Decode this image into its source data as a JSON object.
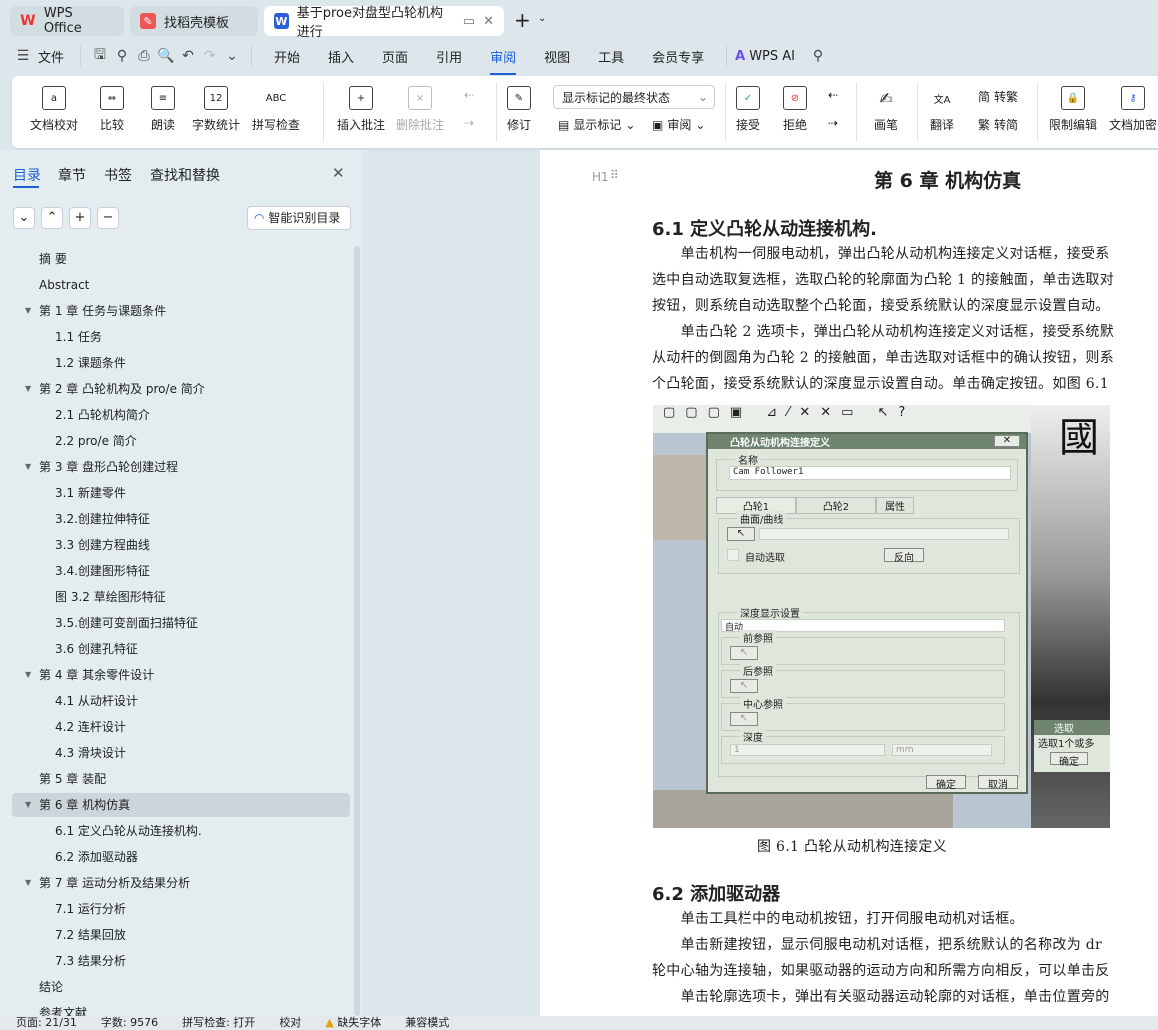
{
  "tabs": [
    {
      "label": "WPS Office",
      "color": "#e33"
    },
    {
      "label": "找稻壳模板",
      "color": "#e55"
    },
    {
      "label": "基于proe对盘型凸轮机构进行",
      "color": "#2b5fd9"
    }
  ],
  "menu": {
    "file": "文件",
    "items": [
      "开始",
      "插入",
      "页面",
      "引用",
      "审阅",
      "视图",
      "工具",
      "会员专享"
    ],
    "active": "审阅",
    "ai": "WPS AI"
  },
  "ribbon": {
    "proof": "文档校对",
    "compare": "比较",
    "read": "朗读",
    "wordcount": "字数统计",
    "spell": "拼写检查",
    "insert_comment": "插入批注",
    "delete_comment": "删除批注",
    "track": "修订",
    "display_select": "显示标记的最终状态",
    "show_markup": "显示标记",
    "review": "审阅",
    "accept": "接受",
    "reject": "拒绝",
    "pen": "画笔",
    "translate": "翻译",
    "to_trad": "转繁",
    "to_simp": "转简",
    "restrict": "限制编辑",
    "encrypt": "文档加密"
  },
  "sidebar": {
    "tabs": [
      "目录",
      "章节",
      "书签",
      "查找和替换"
    ],
    "smart_toc": "智能识别目录",
    "toc": [
      {
        "label": "摘 要",
        "level": 1
      },
      {
        "label": "Abstract",
        "level": 1
      },
      {
        "label": "第 1 章   任务与课题条件",
        "level": 1,
        "expand": true
      },
      {
        "label": "1.1  任务",
        "level": 2
      },
      {
        "label": "1.2  课题条件",
        "level": 2
      },
      {
        "label": "第 2 章  凸轮机构及 pro/e 简介",
        "level": 1,
        "expand": true
      },
      {
        "label": "2.1  凸轮机构简介",
        "level": 2
      },
      {
        "label": "2.2 pro/e 简介",
        "level": 2
      },
      {
        "label": "第 3 章  盘形凸轮创建过程",
        "level": 1,
        "expand": true
      },
      {
        "label": "3.1  新建零件",
        "level": 2
      },
      {
        "label": "3.2.创建拉伸特征",
        "level": 2
      },
      {
        "label": "3.3  创建方程曲线",
        "level": 2
      },
      {
        "label": "3.4.创建图形特征",
        "level": 2
      },
      {
        "label": "图 3.2  草绘图形特征",
        "level": 2
      },
      {
        "label": "3.5.创建可变剖面扫描特征",
        "level": 2
      },
      {
        "label": "3.6 创建孔特征",
        "level": 2
      },
      {
        "label": "第 4 章    其余零件设计",
        "level": 1,
        "expand": true
      },
      {
        "label": "4.1 从动杆设计",
        "level": 2
      },
      {
        "label": "4.2 连杆设计",
        "level": 2
      },
      {
        "label": "4.3 滑块设计",
        "level": 2
      },
      {
        "label": "第 5 章  装配",
        "level": 1
      },
      {
        "label": "第 6 章  机构仿真",
        "level": 1,
        "expand": true,
        "selected": true
      },
      {
        "label": "6.1  定义凸轮从动连接机构.",
        "level": 2
      },
      {
        "label": "6.2  添加驱动器",
        "level": 2
      },
      {
        "label": "第 7 章    运动分析及结果分析",
        "level": 1,
        "expand": true
      },
      {
        "label": "7.1  运行分析",
        "level": 2
      },
      {
        "label": "7.2     结果回放",
        "level": 2
      },
      {
        "label": "7.3     结果分析",
        "level": 2
      },
      {
        "label": "结论",
        "level": 1
      },
      {
        "label": "参考文献",
        "level": 1
      }
    ]
  },
  "doc": {
    "heading_marker": "H1",
    "chapter": "第 6 章  机构仿真",
    "s1": "6.1  定义凸轮从动连接机构.",
    "p1": [
      "　　单击机构一伺服电动机，弹出凸轮从动机构连接定义对话框，接受系",
      "选中自动选取复选框，选取凸轮的轮廓面为凸轮 1 的接触面，单击选取对",
      "按钮，则系统自动选取整个凸轮面，接受系统默认的深度显示设置自动。",
      "　　单击凸轮 2 选项卡，弹出凸轮从动机构连接定义对话框，接受系统默",
      "从动杆的倒圆角为凸轮 2 的接触面，单击选取对话框中的确认按钮，则系",
      "个凸轮面，接受系统默认的深度显示设置自动。单击确定按钮。如图 6.1"
    ],
    "caption": "图 6.1 凸轮从动机构连接定义",
    "s2": "6.2  添加驱动器",
    "p2": [
      "　　单击工具栏中的电动机按钮，打开伺服电动机对话框。",
      "　　单击新建按钮，显示伺服电动机对话框，把系统默认的名称改为 dr",
      "轮中心轴为连接轴，如果驱动器的运动方向和所需方向相反，可以单击反",
      "　　单击轮廓选项卡，弹出有关驱动器运动轮廓的对话框，单击位置旁的"
    ]
  },
  "figure": {
    "title": "凸轮从动机构连接定义",
    "name_label": "名称",
    "name_value": "Cam Follower1",
    "tabs": [
      "凸轮1",
      "凸轮2",
      "属性"
    ],
    "surface": "曲面/曲线",
    "auto": "自动选取",
    "reverse": "反向",
    "depth_settings": "深度显示设置",
    "depth_mode": "自动",
    "front_ref": "前参照",
    "back_ref": "后参照",
    "center_ref": "中心参照",
    "depth": "深度",
    "depth_value": "1",
    "unit": "mm",
    "ok": "确定",
    "cancel": "取消",
    "select_title": "选取",
    "select_text": "选取1个或多",
    "select_ok": "确定",
    "bg_char": "國"
  },
  "status": {
    "page": "页面: 21/31",
    "words": "字数: 9576",
    "spell": "拼写检查: 打开",
    "proof": "校对",
    "missing_font": "缺失字体",
    "compat": "兼容模式"
  }
}
